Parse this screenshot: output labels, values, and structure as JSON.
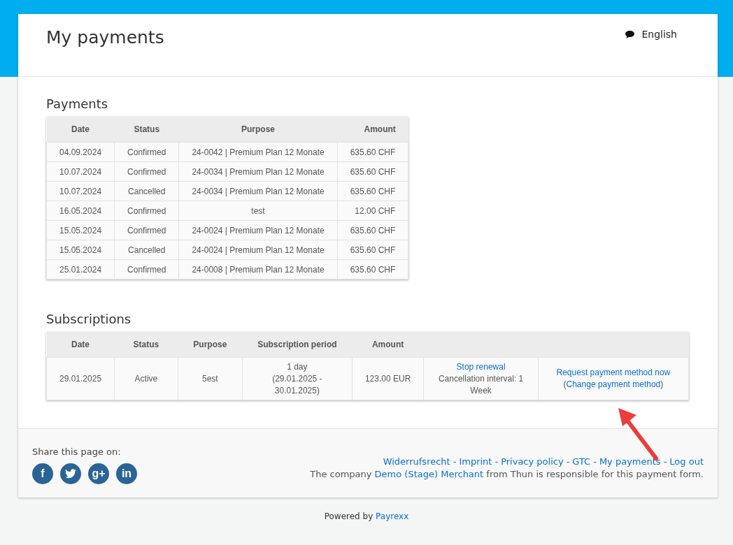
{
  "header": {
    "title": "My payments",
    "language": "English"
  },
  "payments": {
    "title": "Payments",
    "columns": [
      "Date",
      "Status",
      "Purpose",
      "Amount"
    ],
    "rows": [
      {
        "date": "04.09.2024",
        "status": "Confirmed",
        "purpose": "24-0042 | Premium Plan 12 Monate",
        "amount": "635.60 CHF"
      },
      {
        "date": "10.07.2024",
        "status": "Confirmed",
        "purpose": "24-0034 | Premium Plan 12 Monate",
        "amount": "635.60 CHF"
      },
      {
        "date": "10.07.2024",
        "status": "Cancelled",
        "purpose": "24-0034 | Premium Plan 12 Monate",
        "amount": "635.60 CHF"
      },
      {
        "date": "16.05.2024",
        "status": "Confirmed",
        "purpose": "test",
        "amount": "12.00 CHF"
      },
      {
        "date": "15.05.2024",
        "status": "Confirmed",
        "purpose": "24-0024 | Premium Plan 12 Monate",
        "amount": "635.60 CHF"
      },
      {
        "date": "15.05.2024",
        "status": "Cancelled",
        "purpose": "24-0024 | Premium Plan 12 Monate",
        "amount": "635.60 CHF"
      },
      {
        "date": "25.01.2024",
        "status": "Confirmed",
        "purpose": "24-0008 | Premium Plan 12 Monate",
        "amount": "635.60 CHF"
      }
    ]
  },
  "subscriptions": {
    "title": "Subscriptions",
    "columns": [
      "Date",
      "Status",
      "Purpose",
      "Subscription period",
      "Amount"
    ],
    "rows": [
      {
        "date": "29.01.2025",
        "status": "Active",
        "purpose": "5est",
        "period": "1 day",
        "period_range": "(29.01.2025 - 30.01.2025)",
        "amount": "123.00 EUR",
        "stop_link": "Stop renewal",
        "cancellation": "Cancellation interval: 1 Week",
        "request_link": "Request payment method now",
        "change_prefix": "(",
        "change_link": "Change payment method",
        "change_suffix": ")"
      }
    ]
  },
  "footer": {
    "share_label": "Share this page on:",
    "social": [
      {
        "kind": "facebook",
        "glyph": "f"
      },
      {
        "kind": "twitter"
      },
      {
        "kind": "google",
        "glyph": "g+"
      },
      {
        "kind": "linkedin",
        "glyph": "in"
      }
    ],
    "links": [
      "Widerrufsrecht",
      "Imprint",
      "Privacy policy",
      "GTC",
      "My payments",
      "Log out"
    ],
    "separator": "-",
    "company_before": "The company",
    "company_link": "Demo (Stage) Merchant",
    "company_after": "from Thun is responsible for this payment form."
  },
  "powered": {
    "text": "Powered by",
    "link": "Payrexx"
  }
}
